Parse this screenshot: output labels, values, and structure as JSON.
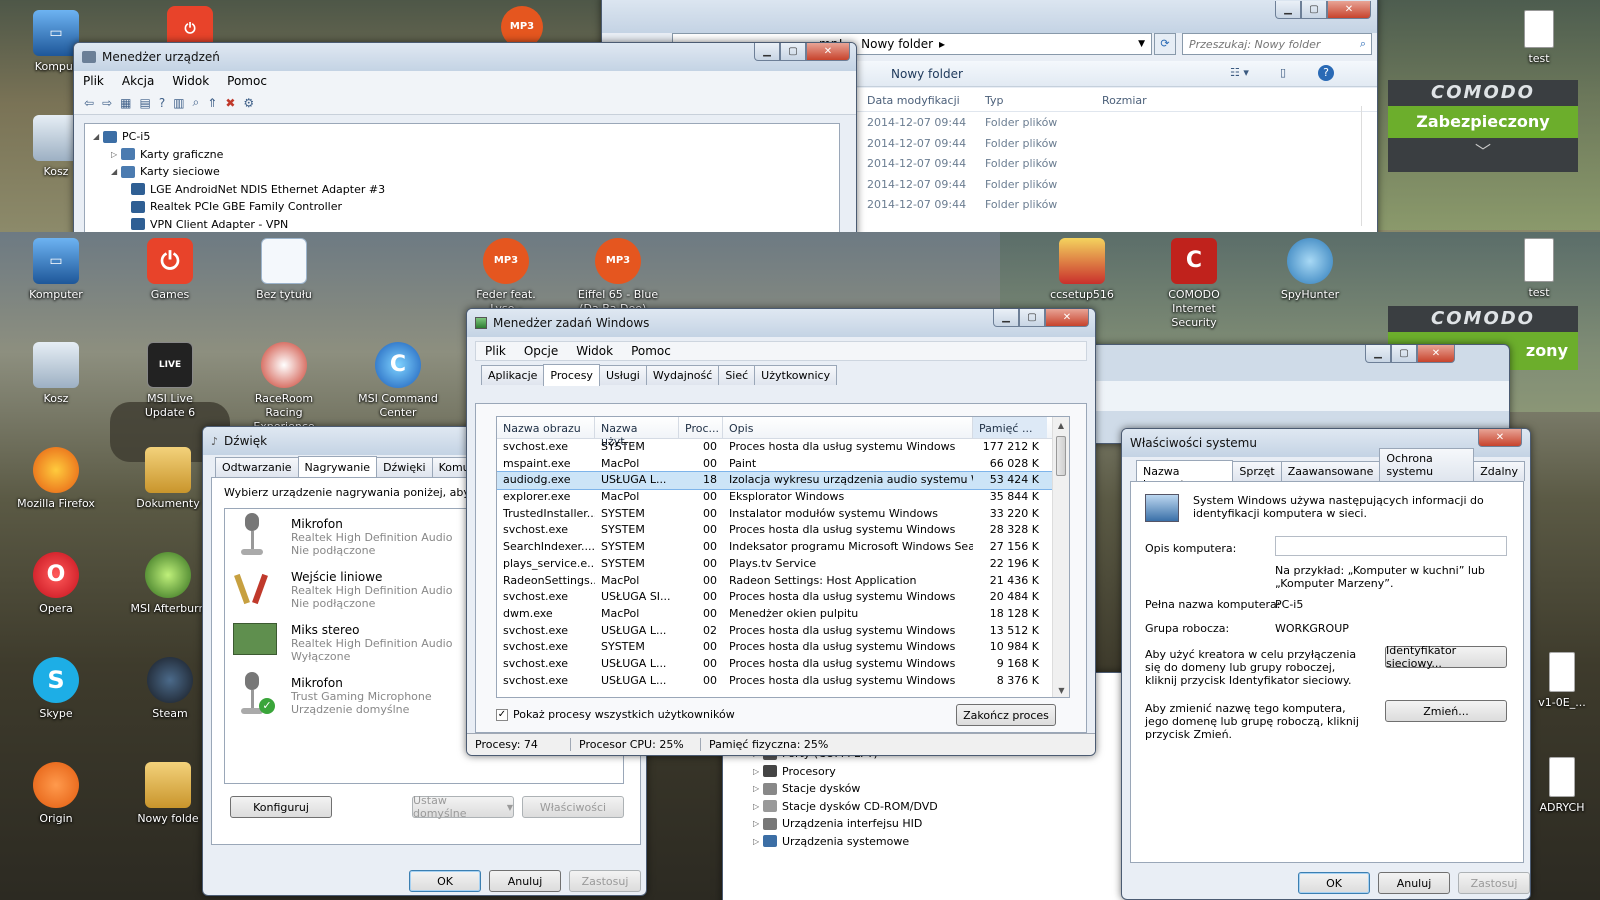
{
  "desktop_top": {
    "icons": [
      {
        "label": "Komput"
      },
      {
        "label": "Kosz"
      },
      {
        "label": "test"
      }
    ],
    "comodo": {
      "brand": "COMODO",
      "status": "Zabezpieczony"
    }
  },
  "desktop": {
    "icons": [
      {
        "label": "Komputer"
      },
      {
        "label": "Games"
      },
      {
        "label": "Bez tytułu"
      },
      {
        "label": "Feder feat. Lyse - Goodbye (Rad..."
      },
      {
        "label": "Eiffel 65 - Blue (Da Ba Dee)..."
      },
      {
        "label": "ccsetup516"
      },
      {
        "label": "COMODO Internet Security"
      },
      {
        "label": "SpyHunter"
      },
      {
        "label": "test"
      },
      {
        "label": "Kosz"
      },
      {
        "label": "MSI Live Update 6"
      },
      {
        "label": "RaceRoom Racing Experience"
      },
      {
        "label": "MSI Command Center"
      },
      {
        "label": "Mozilla Firefox"
      },
      {
        "label": "Dokumenty"
      },
      {
        "label": "Opera"
      },
      {
        "label": "MSI Afterburn"
      },
      {
        "label": "Skype"
      },
      {
        "label": "Steam"
      },
      {
        "label": "Origin"
      },
      {
        "label": "Nowy folde"
      },
      {
        "label": "v1-0E_..."
      },
      {
        "label": "ADRYCH"
      }
    ],
    "comodo": {
      "brand": "COMODO",
      "status_partial": "zony"
    }
  },
  "device_manager": {
    "title": "Menedżer urządzeń",
    "menu": [
      "Plik",
      "Akcja",
      "Widok",
      "Pomoc"
    ],
    "tree": [
      {
        "label": "PC-i5",
        "level": 0
      },
      {
        "label": "Karty graficzne",
        "level": 1
      },
      {
        "label": "Karty sieciowe",
        "level": 1
      },
      {
        "label": "LGE AndroidNet NDIS Ethernet Adapter #3",
        "level": 2
      },
      {
        "label": "Realtek PCIe GBE Family Controller",
        "level": 2
      },
      {
        "label": "VPN Client Adapter - VPN",
        "level": 2
      }
    ]
  },
  "explorer": {
    "breadcrumb": [
      "mp!",
      "Nowy folder"
    ],
    "search_placeholder": "Przeszukaj: Nowy folder",
    "folder_title": "Nowy folder",
    "columns": [
      "Data modyfikacji",
      "Typ",
      "Rozmiar"
    ],
    "rows": [
      {
        "date": "2014-12-07 09:44",
        "type": "Folder plików"
      },
      {
        "date": "2014-12-07 09:44",
        "type": "Folder plików"
      },
      {
        "date": "2014-12-07 09:44",
        "type": "Folder plików"
      },
      {
        "date": "2014-12-07 09:44",
        "type": "Folder plików"
      },
      {
        "date": "2014-12-07 09:44",
        "type": "Folder plików"
      }
    ]
  },
  "sound": {
    "title": "Dźwięk",
    "tabs": [
      "Odtwarzanie",
      "Nagrywanie",
      "Dźwięki",
      "Komunikac"
    ],
    "instruction": "Wybierz urządzenie nagrywania poniżej, aby z",
    "devices": [
      {
        "name": "Mikrofon",
        "driver": "Realtek High Definition Audio",
        "status": "Nie podłączone"
      },
      {
        "name": "Wejście liniowe",
        "driver": "Realtek High Definition Audio",
        "status": "Nie podłączone"
      },
      {
        "name": "Miks stereo",
        "driver": "Realtek High Definition Audio",
        "status": "Wyłączone"
      },
      {
        "name": "Mikrofon",
        "driver": "Trust Gaming Microphone",
        "status": "Urządzenie domyślne"
      }
    ],
    "buttons": {
      "configure": "Konfiguruj",
      "set_default": "Ustaw domyślne",
      "properties": "Właściwości",
      "ok": "OK",
      "cancel": "Anuluj",
      "apply": "Zastosuj"
    }
  },
  "task_manager": {
    "title": "Menedżer zadań Windows",
    "menu": [
      "Plik",
      "Opcje",
      "Widok",
      "Pomoc"
    ],
    "tabs": [
      "Aplikacje",
      "Procesy",
      "Usługi",
      "Wydajność",
      "Sieć",
      "Użytkownicy"
    ],
    "columns": [
      "Nazwa obrazu",
      "Nazwa użyt...",
      "Proc...",
      "Opis",
      "Pamięć ..."
    ],
    "processes": [
      {
        "name": "svchost.exe",
        "user": "SYSTEM",
        "cpu": "00",
        "desc": "Proces hosta dla usług systemu Windows",
        "mem": "177 212 K"
      },
      {
        "name": "mspaint.exe",
        "user": "MacPol",
        "cpu": "00",
        "desc": "Paint",
        "mem": "66 028 K"
      },
      {
        "name": "audiodg.exe",
        "user": "USŁUGA L...",
        "cpu": "18",
        "desc": "Izolacja wykresu urządzenia audio systemu Wi...",
        "mem": "53 424 K"
      },
      {
        "name": "explorer.exe",
        "user": "MacPol",
        "cpu": "00",
        "desc": "Eksplorator Windows",
        "mem": "35 844 K"
      },
      {
        "name": "TrustedInstaller....",
        "user": "SYSTEM",
        "cpu": "00",
        "desc": "Instalator modułów systemu Windows",
        "mem": "33 220 K"
      },
      {
        "name": "svchost.exe",
        "user": "SYSTEM",
        "cpu": "00",
        "desc": "Proces hosta dla usług systemu Windows",
        "mem": "28 328 K"
      },
      {
        "name": "SearchIndexer....",
        "user": "SYSTEM",
        "cpu": "00",
        "desc": "Indeksator programu Microsoft Windows Search",
        "mem": "27 156 K"
      },
      {
        "name": "plays_service.e...",
        "user": "SYSTEM",
        "cpu": "00",
        "desc": "Plays.tv Service",
        "mem": "22 196 K"
      },
      {
        "name": "RadeonSettings....",
        "user": "MacPol",
        "cpu": "00",
        "desc": "Radeon Settings: Host Application",
        "mem": "21 436 K"
      },
      {
        "name": "svchost.exe",
        "user": "USŁUGA SI...",
        "cpu": "00",
        "desc": "Proces hosta dla usług systemu Windows",
        "mem": "20 484 K"
      },
      {
        "name": "dwm.exe",
        "user": "MacPol",
        "cpu": "00",
        "desc": "Menedżer okien pulpitu",
        "mem": "18 128 K"
      },
      {
        "name": "svchost.exe",
        "user": "USŁUGA L...",
        "cpu": "02",
        "desc": "Proces hosta dla usług systemu Windows",
        "mem": "13 512 K"
      },
      {
        "name": "svchost.exe",
        "user": "SYSTEM",
        "cpu": "00",
        "desc": "Proces hosta dla usług systemu Windows",
        "mem": "10 984 K"
      },
      {
        "name": "svchost.exe",
        "user": "USŁUGA L...",
        "cpu": "00",
        "desc": "Proces hosta dla usług systemu Windows",
        "mem": "9 168 K"
      },
      {
        "name": "svchost.exe",
        "user": "USŁUGA L...",
        "cpu": "00",
        "desc": "Proces hosta dla usług systemu Windows",
        "mem": "8 376 K"
      }
    ],
    "selected_index": 2,
    "show_all_label": "Pokaż procesy wszystkich użytkowników",
    "end_process": "Zakończ proces",
    "status": {
      "processes": "Procesy: 74",
      "cpu": "Procesor CPU: 25%",
      "memory": "Pamięć fizyczna: 25%"
    }
  },
  "device_tree_bottom": {
    "items": [
      "Porty (COM i LPT)",
      "Procesory",
      "Stacje dysków",
      "Stacje dysków CD-ROM/DVD",
      "Urządzenia interfejsu HID",
      "Urządzenia systemowe"
    ]
  },
  "system_properties": {
    "title": "Właściwości systemu",
    "tabs": [
      "Nazwa komputera",
      "Sprzęt",
      "Zaawansowane",
      "Ochrona systemu",
      "Zdalny"
    ],
    "intro": "System Windows używa następujących informacji do identyfikacji komputera w sieci.",
    "desc_label": "Opis komputera:",
    "desc_value": "",
    "example": "Na przykład: „Komputer w kuchni” lub „Komputer Marzeny”.",
    "fullname_label": "Pełna nazwa komputera:",
    "fullname_value": "PC-i5",
    "workgroup_label": "Grupa robocza:",
    "workgroup_value": "WORKGROUP",
    "network_id_text": "Aby użyć kreatora w celu przyłączenia się do domeny lub grupy roboczej, kliknij przycisk Identyfikator sieciowy.",
    "network_id_button": "Identyfikator sieciowy...",
    "change_text": "Aby zmienić nazwę tego komputera, jego domenę lub grupę roboczą, kliknij przycisk Zmień.",
    "change_button": "Zmień...",
    "ok": "OK",
    "cancel": "Anuluj",
    "apply": "Zastosuj"
  }
}
